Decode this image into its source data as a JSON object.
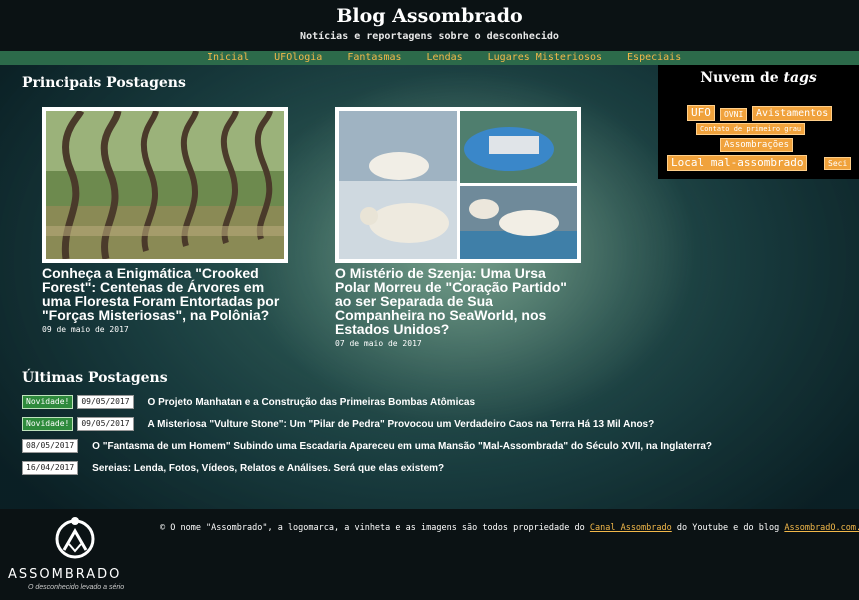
{
  "header": {
    "title": "Blog Assombrado",
    "subtitle": "Notícias e reportagens sobre o desconhecido"
  },
  "nav": {
    "items": [
      {
        "label": "Inicial"
      },
      {
        "label": "UFOlogia"
      },
      {
        "label": "Fantasmas"
      },
      {
        "label": "Lendas"
      },
      {
        "label": "Lugares Misteriosos"
      },
      {
        "label": "Especiais"
      }
    ]
  },
  "featured": {
    "title": "Principais Postagens",
    "posts": [
      {
        "title": "Conheça a Enigmática \"Crooked Forest\": Centenas de Árvores em uma Floresta Foram Entortadas por \"Forças Misteriosas\", na Polônia?",
        "date": "09 de maio de 2017"
      },
      {
        "title": "O Mistério de Szenja: Uma Ursa Polar Morreu de \"Coração Partido\" ao ser Separada de Sua Companheira no SeaWorld, nos Estados Unidos?",
        "date": "07 de maio de 2017"
      }
    ]
  },
  "latest": {
    "title": "Últimas Postagens",
    "new_label": "Novidade!",
    "items": [
      {
        "new": true,
        "date": "09/05/2017",
        "title": "O Projeto Manhatan e a Construção das Primeiras Bombas Atômicas"
      },
      {
        "new": true,
        "date": "09/05/2017",
        "title": "A Misteriosa \"Vulture Stone\": Um \"Pilar de Pedra\" Provocou um Verdadeiro Caos na Terra Há 13 Mil Anos?"
      },
      {
        "new": false,
        "date": "08/05/2017",
        "title": "O \"Fantasma de um Homem\" Subindo uma Escadaria Apareceu em uma Mansão \"Mal-Assombrada\" do Século XVII, na Inglaterra?"
      },
      {
        "new": false,
        "date": "16/04/2017",
        "title": "Sereias: Lenda, Fotos, Vídeos, Relatos e Análises. Será que elas existem?"
      }
    ]
  },
  "tag_cloud": {
    "title_prefix": "Nuvem de ",
    "title_em": "tags",
    "tags": [
      "UFO",
      "OVNI",
      "Avistamentos",
      "Contato de primeiro grau",
      "Assombrações",
      "Local mal-assombrado",
      "Seci"
    ]
  },
  "footer": {
    "text_1": "© O nome \"Assombrado\", a logomarca, a vinheta e as imagens são todos propriedade do ",
    "link_1": "Canal Assombrado",
    "text_2": " do Youtube e do blog ",
    "link_2": "AssombradO.com.br",
    "logo_word": "ASSOMBRADO",
    "logo_slogan": "O desconhecido levado a sério"
  },
  "colors": {
    "accent": "#f2b84a",
    "nav_bg": "#2c6a4a",
    "tag_bg": "#f0a23c",
    "new_badge": "#2e8a3c"
  }
}
